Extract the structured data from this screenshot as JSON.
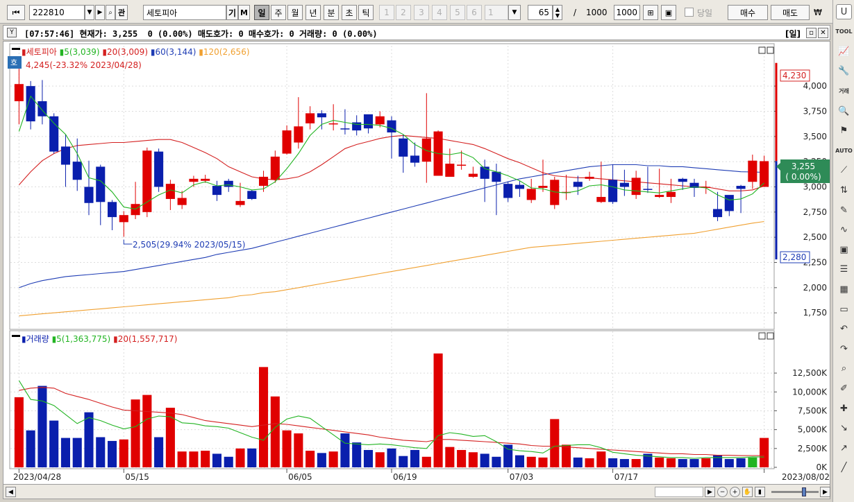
{
  "toolbar": {
    "code": "222810",
    "name": "세토피아",
    "btn_gi": "기",
    "btn_m": "M",
    "periods": [
      "일",
      "주",
      "월",
      "년",
      "분",
      "초",
      "틱"
    ],
    "period_selected": "일",
    "minute_units": [
      "1",
      "2",
      "3",
      "4",
      "5",
      "6"
    ],
    "unit_select": "1",
    "count": "65",
    "count_sep": "/",
    "count_max_label": "1000",
    "count_max_input": "1000",
    "same_day_label": "당일",
    "buy_label": "매수",
    "sell_label": "매도",
    "currency_label": "₩",
    "search_icon": "search-icon",
    "gwan_label": "관"
  },
  "info": {
    "text": "[07:57:46] 현재가: 3,255  0 (0.00%) 매도호가: 0 매수호가: 0 거래량: 0 (0.00%)",
    "period_badge": "[일]"
  },
  "price_panel": {
    "legend": {
      "name": "세토피아",
      "ma5": "5(3,039)",
      "ma20": "20(3,009)",
      "ma60": "60(3,144)",
      "ma120": "120(2,656)"
    },
    "high_annotation": "4,245(-23.32% 2023/04/28)",
    "low_annotation": "2,505(29.94% 2023/05/15)",
    "max_flag": "4,230",
    "min_flag": "2,280",
    "current_flag": "3,255",
    "current_change": "( 0.00%)",
    "badge": "호",
    "y_ticks": [
      "4,000",
      "3,750",
      "3,500",
      "3,250",
      "3,000",
      "2,750",
      "2,500",
      "2,250",
      "2,000",
      "1,750"
    ]
  },
  "volume_panel": {
    "legend": {
      "name": "거래량",
      "ma5": "5(1,363,775)",
      "ma20": "20(1,557,717)"
    },
    "y_ticks": [
      "12,500K",
      "10,000K",
      "7,500K",
      "5,000K",
      "2,500K",
      "0K"
    ]
  },
  "x_labels": [
    "2023/04/28",
    "05/15",
    "06/05",
    "06/19",
    "07/03",
    "07/17",
    "2023/08/02"
  ],
  "colors": {
    "up": "#e00000",
    "down": "#0a1fad",
    "ma5": "#22b422",
    "ma20": "#d42020",
    "ma60": "#1e3cb4",
    "ma120": "#f0a030"
  },
  "right_tools": [
    "TOOL",
    "chart-icon",
    "wrench-icon",
    "거래",
    "search-doc-icon",
    "flag-icon",
    "AUTO",
    "trend-icon",
    "split-icon",
    "tool-icon",
    "line-icon",
    "box-icon",
    "stack-icon",
    "grid-icon",
    "window-icon",
    "undo-icon",
    "redo-icon",
    "zoom-icon",
    "eraser-icon",
    "add-icon",
    "corner-icon",
    "arrow-icon",
    "pen-icon"
  ],
  "chart_data": {
    "type": "candlestick",
    "title": "세토피아",
    "x": [
      "2023/04/28",
      "",
      "",
      "",
      "",
      "",
      "",
      "",
      "",
      "05/15",
      "",
      "",
      "",
      "",
      "",
      "",
      "",
      "",
      "",
      "",
      "",
      "",
      "",
      "06/05",
      "",
      "",
      "",
      "",
      "",
      "",
      "",
      "",
      "06/19",
      "",
      "",
      "",
      "",
      "",
      "",
      "",
      "",
      "",
      "07/03",
      "",
      "",
      "",
      "",
      "",
      "",
      "",
      "",
      "07/17",
      "",
      "",
      "",
      "",
      "",
      "",
      "",
      "",
      "",
      "",
      "",
      "",
      "2023/08/02"
    ],
    "open": [
      3850,
      4000,
      3850,
      3700,
      3400,
      3250,
      3000,
      3200,
      2850,
      2650,
      2720,
      2750,
      3350,
      2880,
      2820,
      3050,
      3060,
      3010,
      3060,
      2820,
      2960,
      3010,
      3070,
      3330,
      3440,
      3630,
      3730,
      3620,
      3580,
      3640,
      3720,
      3620,
      3660,
      3480,
      3310,
      3250,
      3110,
      3100,
      3220,
      3100,
      3200,
      3150,
      3030,
      3020,
      2870,
      2990,
      2820,
      2950,
      3050,
      3080,
      2850,
      3070,
      3040,
      2920,
      2980,
      2900,
      2900,
      3080,
      3040,
      3000,
      2780,
      2920,
      3010,
      3050,
      3000
    ],
    "close": [
      4020,
      3650,
      3700,
      3350,
      3220,
      3070,
      2840,
      2850,
      2700,
      2720,
      2830,
      3360,
      3000,
      3030,
      2890,
      3080,
      3080,
      2920,
      3000,
      2860,
      2880,
      3100,
      3300,
      3560,
      3600,
      3730,
      3690,
      3630,
      3570,
      3560,
      3580,
      3700,
      3540,
      3300,
      3240,
      3480,
      3550,
      3230,
      3220,
      3130,
      3080,
      3050,
      2890,
      2980,
      2980,
      3010,
      3070,
      2950,
      3000,
      3100,
      2900,
      2850,
      3000,
      3090,
      2970,
      2920,
      2950,
      3050,
      2990,
      3000,
      2700,
      2760,
      2980,
      3260,
      3255
    ],
    "high": [
      4230,
      4050,
      4060,
      3730,
      3520,
      3480,
      3260,
      3220,
      2870,
      2760,
      3050,
      3390,
      3380,
      3070,
      2960,
      3110,
      3120,
      3060,
      3080,
      3040,
      2970,
      3160,
      3360,
      3610,
      3890,
      3800,
      3760,
      3820,
      3770,
      3710,
      3700,
      3750,
      3700,
      3520,
      3440,
      3930,
      3560,
      3380,
      3360,
      3200,
      3270,
      3230,
      3050,
      3060,
      3080,
      3270,
      3100,
      3120,
      3110,
      3150,
      3250,
      3220,
      3170,
      3160,
      3200,
      3180,
      3080,
      3090,
      3080,
      3060,
      2950,
      2850,
      3020,
      3320,
      3310
    ],
    "low": [
      3620,
      3570,
      3620,
      3330,
      3000,
      2960,
      2720,
      2620,
      2570,
      2505,
      2680,
      2700,
      2950,
      2770,
      2780,
      3000,
      3040,
      2860,
      2950,
      2800,
      2870,
      2950,
      3040,
      3320,
      3380,
      3570,
      3570,
      3560,
      3520,
      3510,
      3530,
      3590,
      3280,
      3140,
      3200,
      3040,
      3490,
      3150,
      3170,
      3090,
      2850,
      2720,
      2850,
      2900,
      2840,
      2950,
      2780,
      2870,
      2920,
      3060,
      2840,
      2830,
      2910,
      2880,
      2940,
      2890,
      2840,
      2970,
      2900,
      2930,
      2660,
      2710,
      2740,
      2980,
      3100
    ],
    "volume": [
      9300,
      4900,
      10800,
      6200,
      3900,
      3900,
      7300,
      4000,
      3500,
      3700,
      9000,
      9600,
      4000,
      7900,
      2100,
      2100,
      2200,
      1800,
      1400,
      2500,
      2500,
      13300,
      9400,
      4900,
      4500,
      2200,
      1900,
      2100,
      4500,
      3300,
      2300,
      2000,
      2500,
      1500,
      2300,
      1400,
      15100,
      2700,
      2300,
      2000,
      1800,
      1400,
      3000,
      1600,
      1400,
      1300,
      6400,
      3000,
      1300,
      1200,
      2100,
      1200,
      1100,
      1100,
      1800,
      1300,
      1200,
      1100,
      1100,
      1200,
      1600,
      1100,
      1200,
      1300,
      3900
    ],
    "ma5": [
      3550,
      3900,
      3760,
      3630,
      3520,
      3330,
      3090,
      3060,
      2950,
      2800,
      2780,
      2850,
      2920,
      2970,
      2940,
      3020,
      3050,
      3010,
      3020,
      3000,
      2970,
      2980,
      3050,
      3180,
      3330,
      3510,
      3620,
      3660,
      3640,
      3620,
      3620,
      3610,
      3580,
      3520,
      3420,
      3360,
      3330,
      3320,
      3340,
      3290,
      3180,
      3150,
      3110,
      3060,
      2990,
      2980,
      2950,
      2940,
      2960,
      3010,
      3020,
      3000,
      2970,
      2960,
      2950,
      2940,
      2960,
      2980,
      3000,
      2990,
      2920,
      2870,
      2880,
      2930,
      3039
    ],
    "ma20": [
      3020,
      3150,
      3260,
      3330,
      3380,
      3410,
      3420,
      3430,
      3440,
      3440,
      3450,
      3460,
      3470,
      3470,
      3440,
      3390,
      3340,
      3280,
      3200,
      3150,
      3100,
      3080,
      3070,
      3080,
      3100,
      3150,
      3220,
      3300,
      3380,
      3420,
      3450,
      3480,
      3500,
      3510,
      3500,
      3490,
      3480,
      3460,
      3440,
      3420,
      3380,
      3330,
      3280,
      3240,
      3190,
      3140,
      3110,
      3100,
      3090,
      3090,
      3080,
      3070,
      3060,
      3050,
      3040,
      3030,
      3020,
      3010,
      3000,
      3000,
      2980,
      2960,
      2960,
      2970,
      3009
    ],
    "ma60": [
      2000,
      2040,
      2070,
      2090,
      2110,
      2120,
      2130,
      2140,
      2150,
      2160,
      2180,
      2200,
      2220,
      2240,
      2260,
      2280,
      2300,
      2330,
      2350,
      2370,
      2390,
      2420,
      2450,
      2480,
      2510,
      2540,
      2570,
      2600,
      2630,
      2660,
      2690,
      2720,
      2750,
      2780,
      2810,
      2840,
      2870,
      2900,
      2930,
      2960,
      2990,
      3020,
      3050,
      3080,
      3100,
      3120,
      3140,
      3160,
      3180,
      3200,
      3210,
      3220,
      3220,
      3220,
      3210,
      3210,
      3200,
      3200,
      3190,
      3180,
      3170,
      3160,
      3150,
      3148,
      3144
    ],
    "ma120": [
      1720,
      1730,
      1740,
      1750,
      1760,
      1770,
      1780,
      1790,
      1800,
      1810,
      1820,
      1830,
      1840,
      1850,
      1860,
      1870,
      1880,
      1890,
      1900,
      1920,
      1930,
      1950,
      1960,
      1980,
      2000,
      2020,
      2040,
      2060,
      2080,
      2100,
      2120,
      2140,
      2160,
      2180,
      2200,
      2220,
      2240,
      2260,
      2280,
      2300,
      2320,
      2340,
      2360,
      2380,
      2400,
      2410,
      2420,
      2430,
      2440,
      2450,
      2460,
      2470,
      2480,
      2490,
      2500,
      2510,
      2520,
      2530,
      2540,
      2560,
      2580,
      2600,
      2620,
      2640,
      2656
    ],
    "vol_ma5": [
      11500,
      9000,
      8800,
      8200,
      7000,
      5800,
      6600,
      6200,
      5600,
      5100,
      5400,
      6400,
      6800,
      6700,
      5900,
      5800,
      5500,
      5400,
      5200,
      4600,
      4000,
      3600,
      5300,
      6400,
      6800,
      6500,
      5400,
      4300,
      3200,
      3100,
      3000,
      3100,
      3000,
      2800,
      2600,
      2500,
      4200,
      4600,
      4400,
      4100,
      4200,
      3400,
      2400,
      2200,
      2100,
      1900,
      2800,
      2900,
      3000,
      3000,
      2600,
      2000,
      1800,
      1600,
      1500,
      1400,
      1300,
      1300,
      1200,
      1300,
      1300,
      1300,
      1300,
      1400,
      1364
    ],
    "vol_ma20": [
      10200,
      10500,
      10600,
      10500,
      9800,
      9400,
      9000,
      8500,
      8000,
      7600,
      7500,
      7400,
      7300,
      7200,
      7000,
      6600,
      6200,
      6000,
      5800,
      5600,
      5400,
      5600,
      5800,
      5700,
      5500,
      5300,
      5100,
      4900,
      4700,
      4500,
      4300,
      4000,
      3800,
      3600,
      3500,
      3400,
      3700,
      3700,
      3600,
      3500,
      3400,
      3300,
      3200,
      3100,
      2900,
      2800,
      2800,
      2700,
      2600,
      2500,
      2400,
      2300,
      2200,
      2100,
      2000,
      1900,
      1800,
      1800,
      1700,
      1700,
      1600,
      1600,
      1550,
      1560,
      1558
    ],
    "ylim_price": [
      1600,
      4400
    ],
    "ylim_volume": [
      0,
      16000
    ],
    "series": [
      {
        "name": "5(3,039)"
      },
      {
        "name": "20(3,009)"
      },
      {
        "name": "60(3,144)"
      },
      {
        "name": "120(2,656)"
      }
    ]
  }
}
